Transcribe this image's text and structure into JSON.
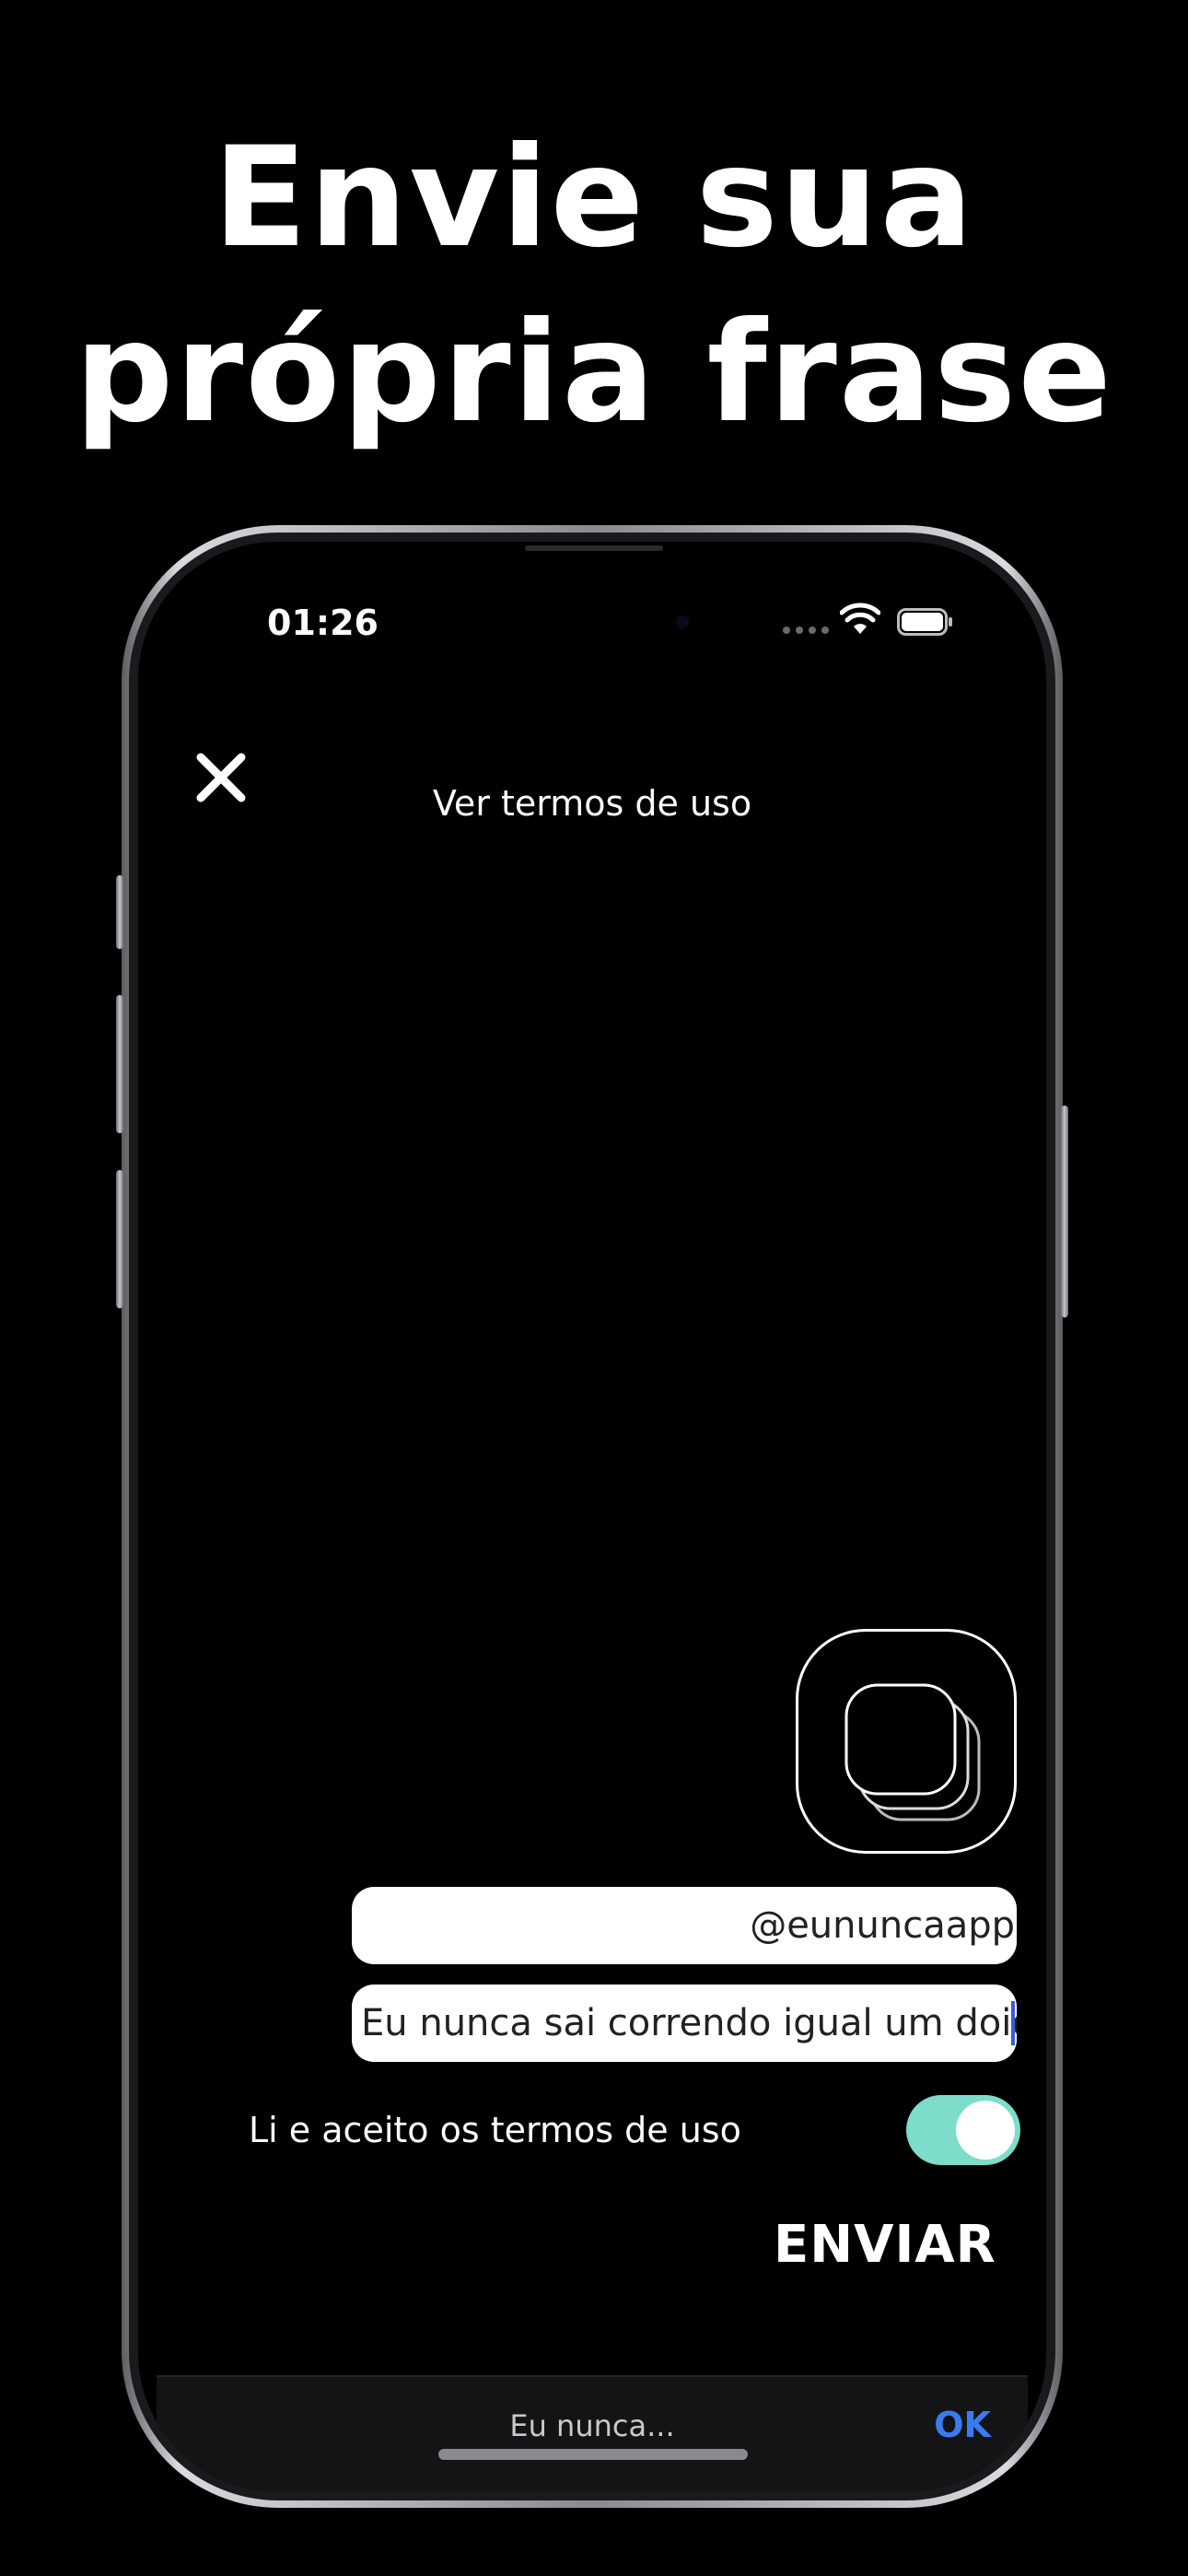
{
  "headline": {
    "line1": "Envie sua",
    "line2": "própria frase"
  },
  "status_bar": {
    "time": "01:26",
    "icons": [
      "signal-dots-icon",
      "wifi-icon",
      "battery-icon"
    ]
  },
  "header": {
    "close_icon": "close-icon",
    "terms_link": "Ver termos de uso"
  },
  "form": {
    "stack_icon": "cards-stack-icon",
    "username_value": "@eununcaapp",
    "phrase_value": "Eu nunca sai correndo igual um doido",
    "accept_label": "Li e aceito os termos de uso",
    "accept_toggle_on": true,
    "send_label": "ENVIAR"
  },
  "keyboard": {
    "suggestion": "Eu nunca...",
    "ok_label": "OK"
  },
  "colors": {
    "background": "#000000",
    "toggle_on": "#7ddcca",
    "ok_accent": "#3b7bf0",
    "caret": "#3b5bdb"
  }
}
